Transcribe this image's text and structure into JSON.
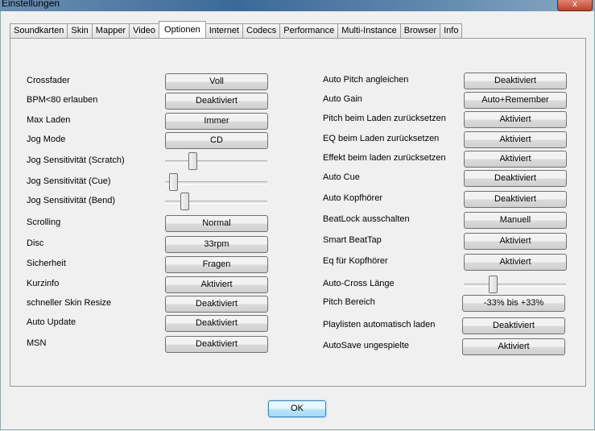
{
  "window": {
    "title": "Einstellungen",
    "close": "x"
  },
  "tabs": [
    "Soundkarten",
    "Skin",
    "Mapper",
    "Video",
    "Optionen",
    "Internet",
    "Codecs",
    "Performance",
    "Multi-Instance",
    "Browser",
    "Info"
  ],
  "active_tab": "Optionen",
  "left": [
    {
      "label": "Crossfader",
      "value": "Voll"
    },
    {
      "label": "BPM<80 erlauben",
      "value": "Deaktiviert"
    },
    {
      "label": "Max Laden",
      "value": "Immer"
    },
    {
      "label": "Jog Mode",
      "value": "CD"
    },
    {
      "label": "Jog Sensitivität (Scratch)",
      "slider": 0.25
    },
    {
      "label": "Jog Sensitivität (Cue)",
      "slider": 0.05
    },
    {
      "label": "Jog Sensitivität (Bend)",
      "slider": 0.17
    },
    {
      "label": "Scrolling",
      "value": "Normal"
    },
    {
      "label": "Disc",
      "value": "33rpm"
    },
    {
      "label": "Sicherheit",
      "value": "Fragen"
    },
    {
      "label": "Kurzinfo",
      "value": "Aktiviert"
    },
    {
      "label": "schneller Skin Resize",
      "value": "Deaktiviert"
    },
    {
      "label": "Auto Update",
      "value": "Deaktiviert"
    },
    {
      "label": "MSN",
      "value": "Deaktiviert"
    }
  ],
  "right": [
    {
      "label": "Auto Pitch angleichen",
      "value": "Deaktiviert"
    },
    {
      "label": "Auto Gain",
      "value": "Auto+Remember"
    },
    {
      "label": "Pitch beim Laden zurücksetzen",
      "value": "Aktiviert"
    },
    {
      "label": "EQ beim Laden zurücksetzen",
      "value": "Aktiviert"
    },
    {
      "label": "Effekt beim laden zurücksetzen",
      "value": "Aktiviert"
    },
    {
      "label": "Auto Cue",
      "value": "Deaktiviert"
    },
    {
      "label": "Auto Kopfhörer",
      "value": "Deaktiviert"
    },
    {
      "label": "BeatLock ausschalten",
      "value": "Manuell"
    },
    {
      "label": "Smart BeatTap",
      "value": "Aktiviert"
    },
    {
      "label": "Eq für Kopfhörer",
      "value": "Aktiviert"
    },
    {
      "label": "Auto-Cross Länge",
      "slider": 0.27
    },
    {
      "label": "Pitch Bereich",
      "value": "-33% bis +33%"
    },
    {
      "label": "Playlisten automatisch laden",
      "value": "Deaktiviert"
    },
    {
      "label": "AutoSave ungespielte",
      "value": "Aktiviert"
    }
  ],
  "ok_label": "OK"
}
